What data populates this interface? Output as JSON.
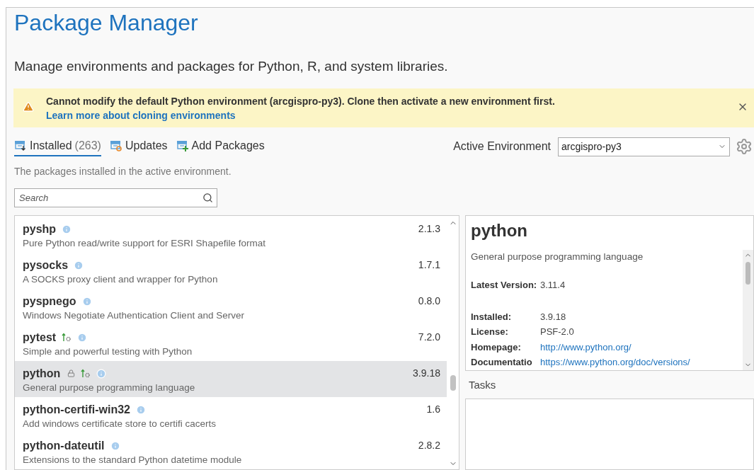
{
  "title": "Package Manager",
  "subtitle": "Manage environments and packages for Python, R, and system libraries.",
  "warning": {
    "text": "Cannot modify the default Python environment (arcgispro-py3). Clone then activate a new environment first.",
    "link": "Learn more about cloning environments"
  },
  "tabs": [
    {
      "label": "Installed",
      "count": "(263)",
      "kind": "installed",
      "selected": true
    },
    {
      "label": "Updates",
      "kind": "updates",
      "selected": false
    },
    {
      "label": "Add Packages",
      "kind": "add",
      "selected": false
    }
  ],
  "active_environment": {
    "label": "Active Environment",
    "value": "arcgispro-py3"
  },
  "tab_description": "The packages installed in the active environment.",
  "search": {
    "placeholder": "Search"
  },
  "packages": [
    {
      "name": "pyshp",
      "description": "Pure Python read/write support for ESRI Shapefile format",
      "version": "2.1.3",
      "locked": false,
      "update_available": false,
      "selected": false
    },
    {
      "name": "pysocks",
      "description": "A SOCKS proxy client and wrapper for Python",
      "version": "1.7.1",
      "locked": false,
      "update_available": false,
      "selected": false
    },
    {
      "name": "pyspnego",
      "description": "Windows Negotiate Authentication Client and Server",
      "version": "0.8.0",
      "locked": false,
      "update_available": false,
      "selected": false
    },
    {
      "name": "pytest",
      "description": "Simple and powerful testing with Python",
      "version": "7.2.0",
      "locked": false,
      "update_available": true,
      "selected": false
    },
    {
      "name": "python",
      "description": "General purpose programming language",
      "version": "3.9.18",
      "locked": true,
      "update_available": true,
      "selected": true
    },
    {
      "name": "python-certifi-win32",
      "description": "Add windows certificate store to certifi cacerts",
      "version": "1.6",
      "locked": false,
      "update_available": false,
      "selected": false
    },
    {
      "name": "python-dateutil",
      "description": "Extensions to the standard Python datetime module",
      "version": "2.8.2",
      "locked": false,
      "update_available": false,
      "selected": false
    }
  ],
  "details": {
    "name": "python",
    "description": "General purpose programming language",
    "latest": {
      "label": "Latest Version:",
      "value": "3.11.4"
    },
    "fields": [
      {
        "label": "Installed:",
        "value": "3.9.18",
        "kind": "text"
      },
      {
        "label": "License:",
        "value": "PSF-2.0",
        "kind": "text"
      },
      {
        "label": "Homepage:",
        "value": "http://www.python.org/",
        "kind": "link"
      },
      {
        "label": "Documentatio",
        "value": "https://www.python.org/doc/versions/",
        "kind": "link"
      }
    ]
  },
  "tasks": {
    "title": "Tasks"
  }
}
